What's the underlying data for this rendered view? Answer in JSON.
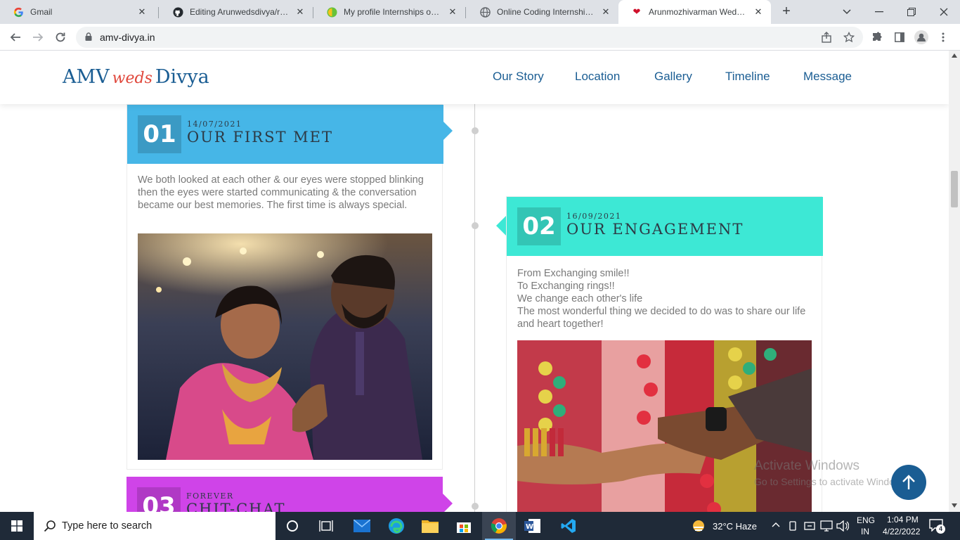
{
  "browser": {
    "tabs": [
      {
        "title": "Gmail",
        "active": false
      },
      {
        "title": "Editing Arunwedsdivya/readme",
        "active": false
      },
      {
        "title": "My profile Internships online",
        "active": false
      },
      {
        "title": "Online Coding Internship - Sh",
        "active": false
      },
      {
        "title": "Arunmozhivarman Weds Divya",
        "active": true
      }
    ],
    "url": "amv-divya.in"
  },
  "site": {
    "logo": {
      "left": "AMV",
      "middle": "weds",
      "right": "Divya"
    },
    "nav": [
      "Our Story",
      "Location",
      "Gallery",
      "Timeline",
      "Message"
    ]
  },
  "timeline": [
    {
      "number": "01",
      "date": "14/07/2021",
      "title": "OUR FIRST MET",
      "color": "#46b6e7",
      "text": "We both looked at each other & our eyes were stopped blinking then the eyes were started communicating & the conversation became our best memories. The first time is always special."
    },
    {
      "number": "02",
      "date": "16/09/2021",
      "title": "OUR ENGAGEMENT",
      "color": "#3de8d5",
      "lines": [
        "From Exchanging smile!!",
        "To Exchanging rings!!",
        "We change each other's life",
        "The most wonderful thing we decided to do was to share our life and heart together!"
      ]
    },
    {
      "number": "03",
      "date": "FOREVER",
      "title": "CHIT-CHAT",
      "color": "#cf44e8"
    }
  ],
  "watermark": {
    "line1": "Activate Windows",
    "line2": "Go to Settings to activate Windows."
  },
  "taskbar": {
    "search_placeholder": "Type here to search",
    "weather": "32°C  Haze",
    "lang1": "ENG",
    "lang2": "IN",
    "time": "1:04 PM",
    "date": "4/22/2022",
    "notifications": "4"
  }
}
